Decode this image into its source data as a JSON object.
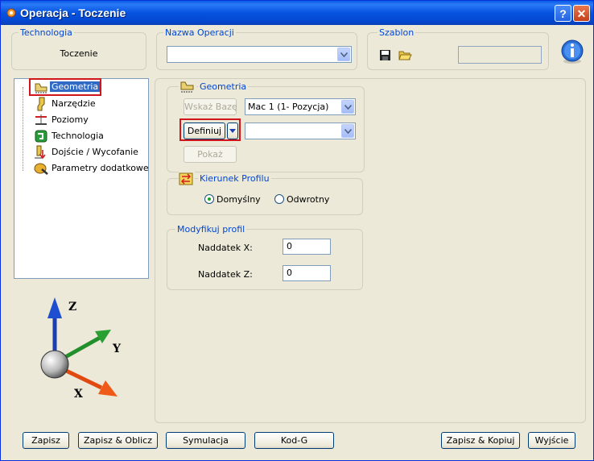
{
  "window": {
    "title": "Operacja - Toczenie",
    "help_label": "?",
    "close_label": "✕"
  },
  "technologia": {
    "title": "Technologia",
    "value": "Toczenie"
  },
  "nazwa_operacji": {
    "title": "Nazwa Operacji",
    "value": ""
  },
  "szablon": {
    "title": "Szablon",
    "value": ""
  },
  "tree": {
    "items": [
      {
        "label": "Geometria",
        "icon": "geometry-icon",
        "selected": true
      },
      {
        "label": "Narzędzie",
        "icon": "tool-icon"
      },
      {
        "label": "Poziomy",
        "icon": "levels-icon"
      },
      {
        "label": "Technologia",
        "icon": "technology-icon"
      },
      {
        "label": "Dojście / Wycofanie",
        "icon": "approach-retract-icon"
      },
      {
        "label": "Parametry dodatkowe",
        "icon": "additional-params-icon"
      }
    ]
  },
  "geometria": {
    "title": "Geometria",
    "wskaz_baze": "Wskaż Bazę",
    "mac_combo": "Mac 1 (1- Pozycja)",
    "definiuj": "Definiuj",
    "definiuj_combo": "",
    "pokaz": "Pokaż"
  },
  "kierunek": {
    "title": "Kierunek Profilu",
    "option1": "Domyślny",
    "option2": "Odwrotny",
    "selected": "Domyślny"
  },
  "modyfikuj": {
    "title": "Modyfikuj profil",
    "naddatek_x_label": "Naddatek X:",
    "naddatek_x": "0",
    "naddatek_z_label": "Naddatek Z:",
    "naddatek_z": "0"
  },
  "axes": {
    "z": "Z",
    "y": "Y",
    "x": "X"
  },
  "buttons": {
    "zapisz": "Zapisz",
    "zapisz_oblicz": "Zapisz & Oblicz",
    "symulacja": "Symulacja",
    "kod_g": "Kod-G",
    "zapisz_kopiuj": "Zapisz & Kopiuj",
    "wyjscie": "Wyjście"
  },
  "colors": {
    "accent": "#0046d5",
    "highlight": "#d0151b",
    "titlebar": "#0553e0"
  }
}
